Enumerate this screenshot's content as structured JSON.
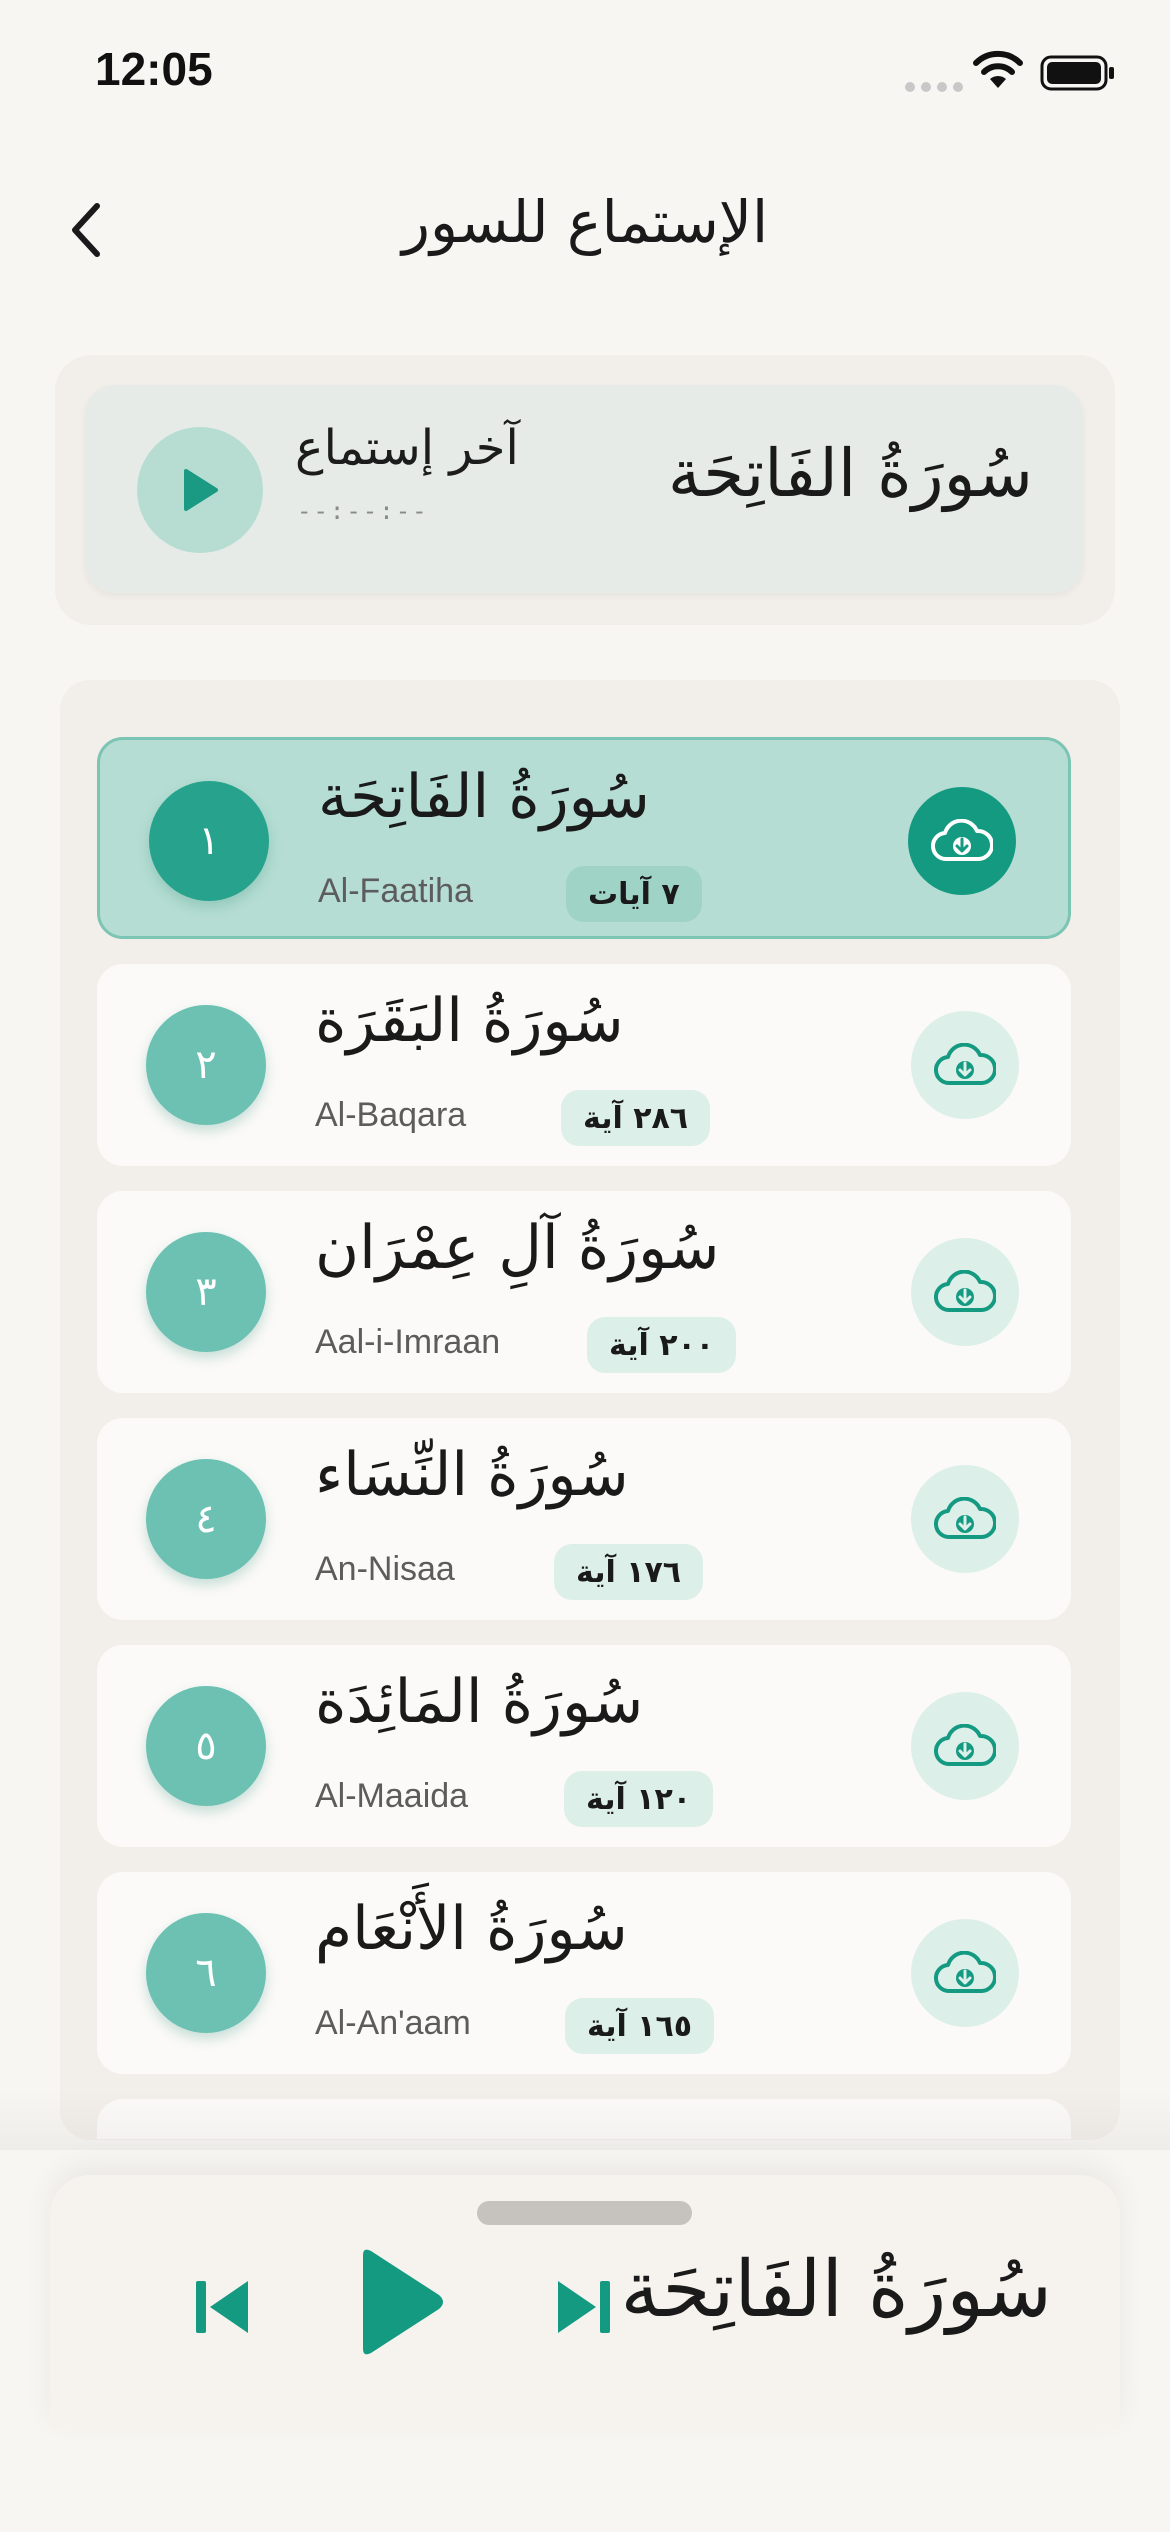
{
  "status_bar": {
    "time": "12:05"
  },
  "header": {
    "title": "الإستماع للسور"
  },
  "last_listen": {
    "label": "آخر إستماع",
    "time": "--:--:--",
    "surah": "سُورَةُ الفَاتِحَة"
  },
  "surahs": [
    {
      "number": "١",
      "name": "سُورَةُ الفَاتِحَة",
      "translit": "Al-Faatiha",
      "ayahs": "٧ آيات",
      "active": true
    },
    {
      "number": "٢",
      "name": "سُورَةُ البَقَرَة",
      "translit": "Al-Baqara",
      "ayahs": "٢٨٦ آية",
      "active": false
    },
    {
      "number": "٣",
      "name": "سُورَةُ آلِ عِمْرَان",
      "translit": "Aal-i-Imraan",
      "ayahs": "٢٠٠ آية",
      "active": false
    },
    {
      "number": "٤",
      "name": "سُورَةُ النِّسَاء",
      "translit": "An-Nisaa",
      "ayahs": "١٧٦ آية",
      "active": false
    },
    {
      "number": "٥",
      "name": "سُورَةُ المَائِدَة",
      "translit": "Al-Maaida",
      "ayahs": "١٢٠ آية",
      "active": false
    },
    {
      "number": "٦",
      "name": "سُورَةُ الأَنْعَام",
      "translit": "Al-An'aam",
      "ayahs": "١٦٥ آية",
      "active": false
    }
  ],
  "player": {
    "surah": "سُورَةُ الفَاتِحَة"
  },
  "colors": {
    "accent": "#159a82",
    "accent_light": "#b5ddd3",
    "background": "#f8f6f2"
  },
  "icons": {
    "back": "chevron-left-icon",
    "download": "cloud-download-icon",
    "play": "play-icon",
    "prev": "skip-previous-icon",
    "next": "skip-next-icon"
  }
}
